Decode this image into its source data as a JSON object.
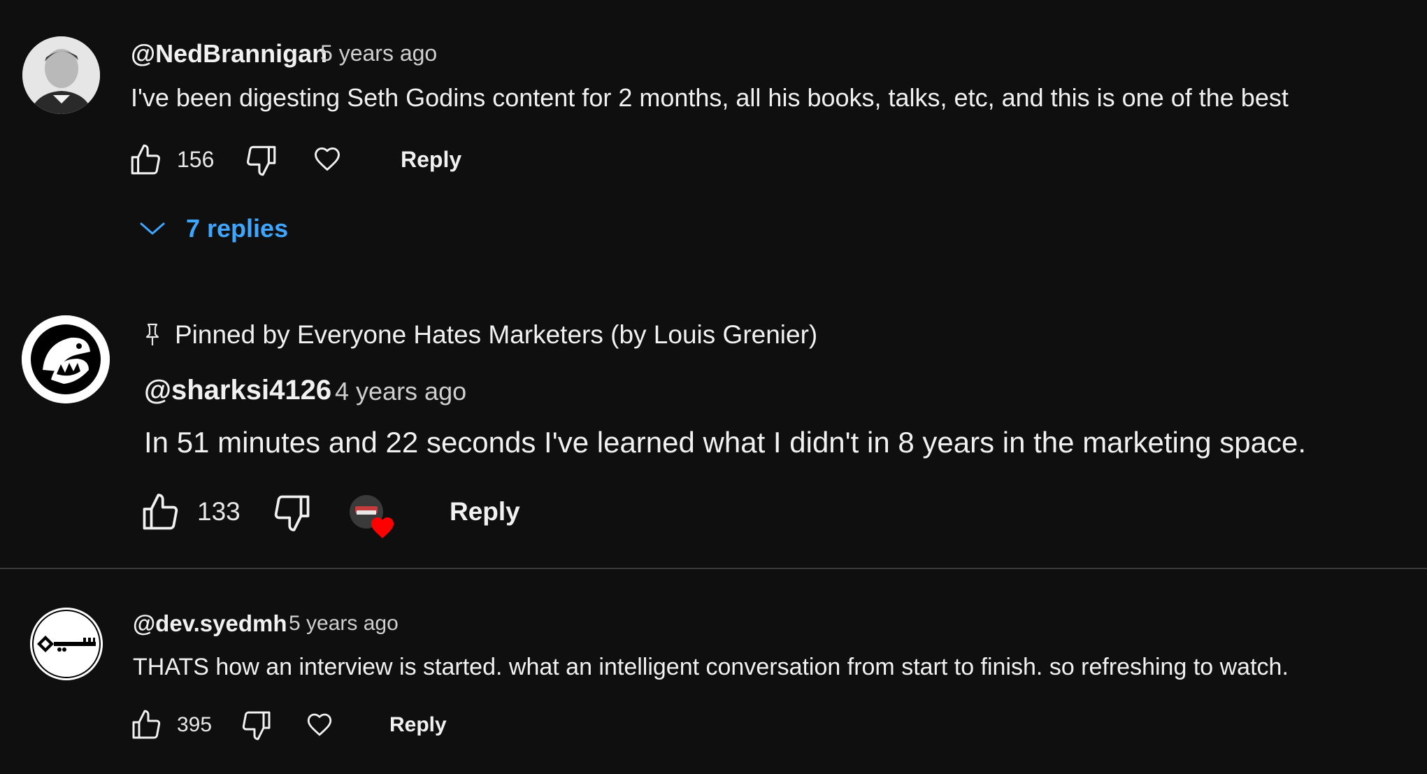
{
  "comments": [
    {
      "author": "@NedBrannigan",
      "time": "5 years ago",
      "text": "I've been digesting Seth Godins content for 2 months, all his books, talks, etc, and this is one of the best",
      "likes": "156",
      "reply_label": "Reply",
      "replies_label": "7 replies"
    },
    {
      "pinned_label": "Pinned by Everyone Hates Marketers (by Louis Grenier)",
      "author": "@sharksi4126",
      "time": "4 years ago",
      "text": "In 51 minutes and 22 seconds I've learned what I didn't in 8 years in the marketing space.",
      "likes": "133",
      "reply_label": "Reply",
      "creator_heart": true
    },
    {
      "author": "@dev.syedmh",
      "time": "5 years ago",
      "text": "THATS how an interview is started. what an intelligent conversation from start to finish. so refreshing to watch.",
      "likes": "395",
      "reply_label": "Reply"
    }
  ],
  "colors": {
    "background": "#0f0f0f",
    "text": "#f1f1f1",
    "link": "#3ea6ff",
    "heart": "#ff0000",
    "divider": "#3a3a3a"
  },
  "icons": [
    "thumb-up-icon",
    "thumb-down-icon",
    "heart-icon",
    "chevron-down-icon",
    "pin-icon"
  ]
}
